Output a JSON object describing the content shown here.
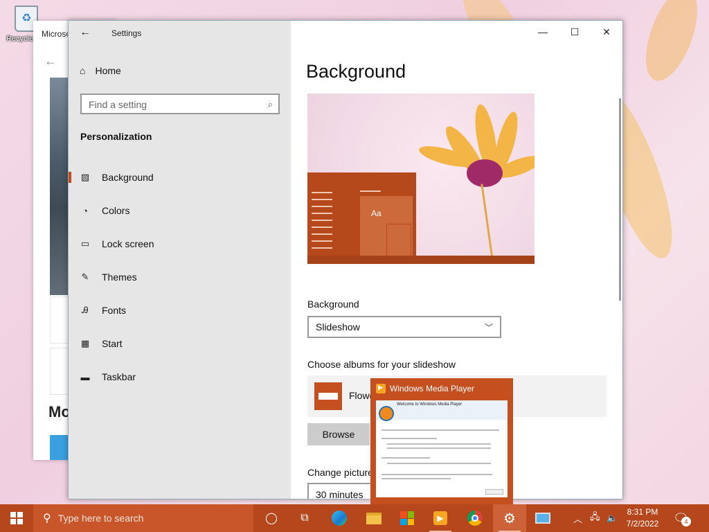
{
  "desktop": {
    "recycle_bin_label": "Recycle Bin"
  },
  "background_window": {
    "title": "Microsoft Store",
    "section_heading": "Mo"
  },
  "settings": {
    "title": "Settings",
    "nav": {
      "home": "Home",
      "search_placeholder": "Find a setting",
      "section": "Personalization",
      "items": [
        {
          "label": "Background",
          "icon": "picture-icon",
          "glyph": "🖾"
        },
        {
          "label": "Colors",
          "icon": "palette-icon",
          "glyph": "🎨"
        },
        {
          "label": "Lock screen",
          "icon": "lock-screen-icon",
          "glyph": "▭"
        },
        {
          "label": "Themes",
          "icon": "brush-icon",
          "glyph": "✎"
        },
        {
          "label": "Fonts",
          "icon": "font-icon",
          "glyph": "A"
        },
        {
          "label": "Start",
          "icon": "start-icon",
          "glyph": "▦"
        },
        {
          "label": "Taskbar",
          "icon": "taskbar-icon",
          "glyph": "▬"
        }
      ],
      "active_index": 0
    },
    "main": {
      "page_title": "Background",
      "preview_tile_text": "Aa",
      "background_label": "Background",
      "background_value": "Slideshow",
      "albums_label": "Choose albums for your slideshow",
      "album_name": "Flowers",
      "browse_label": "Browse",
      "change_picture_label": "Change picture every",
      "change_picture_value": "30 minutes"
    },
    "accent_color": "#c74a1e"
  },
  "wmp_preview": {
    "title": "Windows Media Player",
    "welcome": "Welcome to Windows Media Player"
  },
  "taskbar": {
    "search_placeholder": "Type here to search",
    "time": "8:31 PM",
    "date": "7/2/2022",
    "notification_count": "4",
    "color": "#b6461c"
  }
}
